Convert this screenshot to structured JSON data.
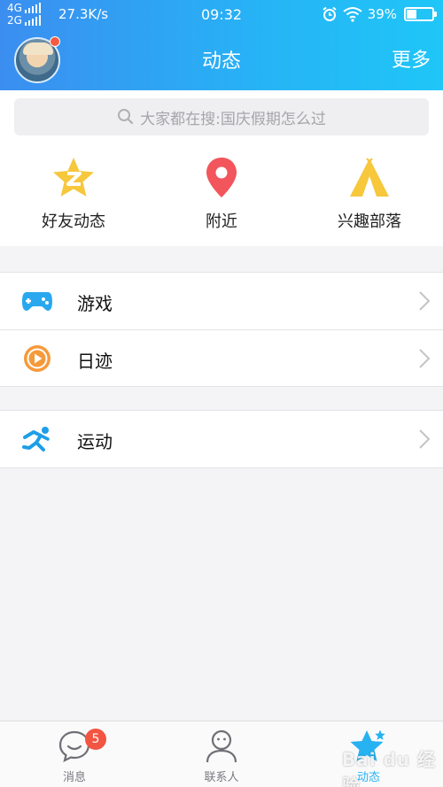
{
  "status_bar": {
    "network_top": "4G",
    "network_bottom": "2G",
    "speed": "27.3K/s",
    "time": "09:32",
    "battery": "39%",
    "battery_level": 0.39
  },
  "header": {
    "title": "动态",
    "more_label": "更多"
  },
  "search": {
    "placeholder": "大家都在搜:国庆假期怎么过"
  },
  "quick_entries": [
    {
      "label": "好友动态",
      "icon": "star-z-icon",
      "color": "#f7c73c"
    },
    {
      "label": "附近",
      "icon": "location-pin-icon",
      "color": "#f2555c"
    },
    {
      "label": "兴趣部落",
      "icon": "tent-icon",
      "color": "#f7c73c"
    }
  ],
  "menu_group_1": [
    {
      "label": "游戏",
      "icon": "gamepad-icon",
      "color": "#2aa8ef"
    },
    {
      "label": "日迹",
      "icon": "play-circle-icon",
      "color": "#f59a3a"
    }
  ],
  "menu_group_2": [
    {
      "label": "运动",
      "icon": "runner-icon",
      "color": "#1e9ee8"
    }
  ],
  "tabs": [
    {
      "label": "消息",
      "icon": "chat-smile-icon",
      "badge": "5"
    },
    {
      "label": "联系人",
      "icon": "person-icon"
    },
    {
      "label": "动态",
      "icon": "star-icon",
      "active": true
    }
  ],
  "watermark": "Bai du 经验",
  "colors": {
    "accent": "#27b2f2",
    "header_gradient_start": "#3b8ef0",
    "header_gradient_end": "#1fc6f7",
    "badge": "#f25542"
  }
}
